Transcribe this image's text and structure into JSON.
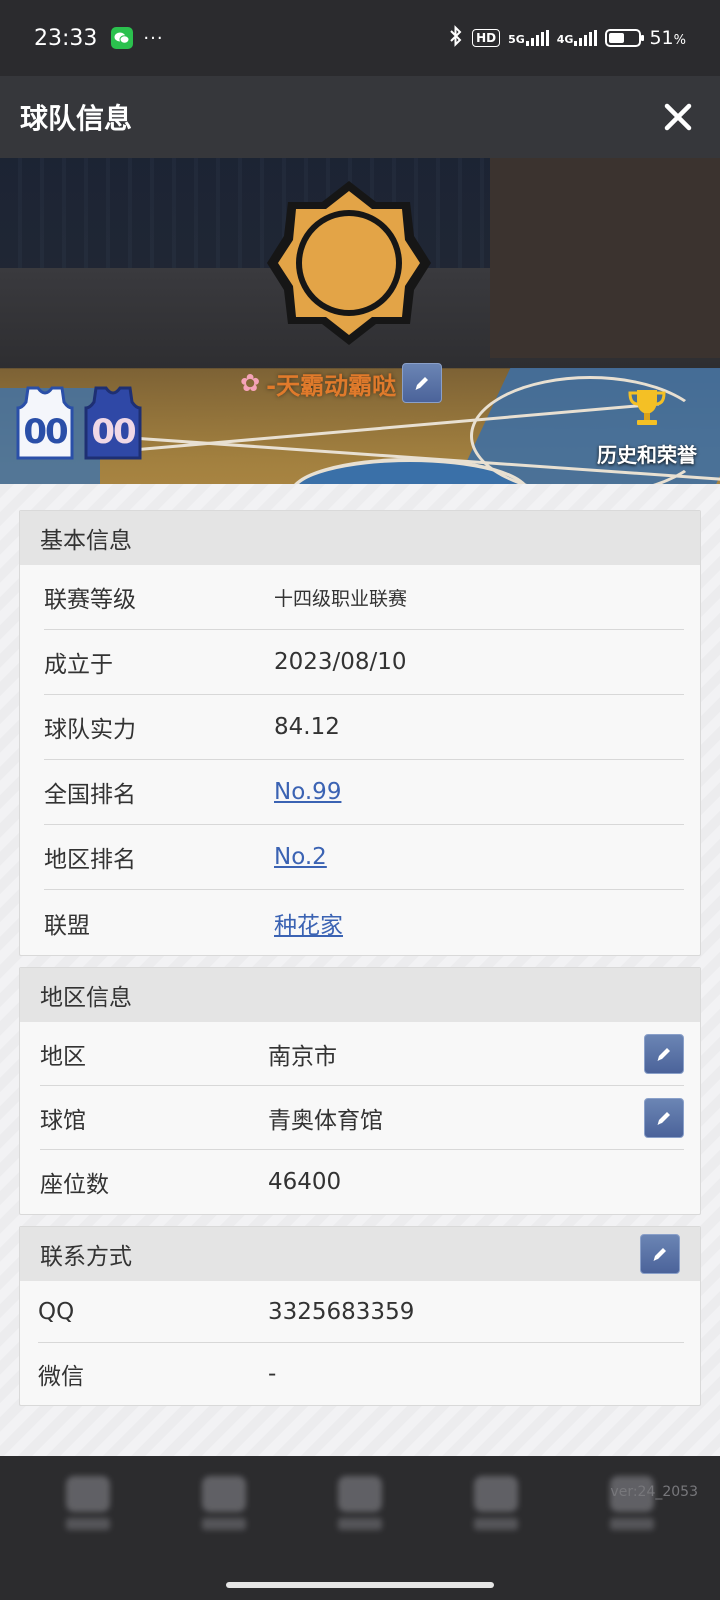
{
  "status_bar": {
    "time": "23:33",
    "more": "···",
    "hd": "HD",
    "net1": "5G",
    "net2": "4G",
    "battery_level": 0.51,
    "battery_text": "51",
    "battery_unit": "%"
  },
  "header": {
    "title": "球队信息"
  },
  "banner": {
    "team_name": "-天霸动霸哒",
    "jersey_home_number": "00",
    "jersey_away_number": "00",
    "honors_label": "历史和荣誉",
    "logo_color": "#e3a447"
  },
  "basic_info": {
    "title": "基本信息",
    "rows": [
      {
        "label": "联赛等级",
        "value": "十四级职业联赛"
      },
      {
        "label": "成立于",
        "value": "2023/08/10"
      },
      {
        "label": "球队实力",
        "value": "84.12"
      },
      {
        "label": "全国排名",
        "value": "No.99"
      },
      {
        "label": "地区排名",
        "value": "No.2"
      },
      {
        "label": "联盟",
        "value": "种花家"
      }
    ]
  },
  "region_info": {
    "title": "地区信息",
    "rows": [
      {
        "label": "地区",
        "value": "南京市"
      },
      {
        "label": "球馆",
        "value": "青奥体育馆"
      },
      {
        "label": "座位数",
        "value": "46400"
      }
    ]
  },
  "contact": {
    "title": "联系方式",
    "rows": [
      {
        "label": "QQ",
        "value": "3325683359"
      },
      {
        "label": "微信",
        "value": "-"
      }
    ]
  },
  "footer": {
    "version": "ver:24_2053"
  },
  "colors": {
    "link": "#3b63b3",
    "edit_button": "#5870a6",
    "team_name": "#e07a2b"
  }
}
